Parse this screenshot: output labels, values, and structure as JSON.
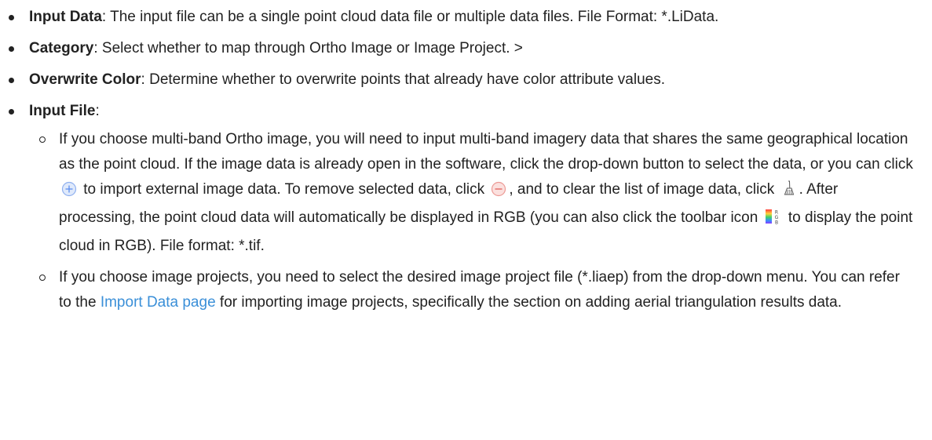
{
  "items": [
    {
      "term": "Input Data",
      "desc": ": The input file can be a single point cloud data file or multiple data files. File Format: *.LiData."
    },
    {
      "term": "Category",
      "desc": ": Select whether to map through Ortho Image or Image Project. >"
    },
    {
      "term": "Overwrite Color",
      "desc": ": Determine whether to overwrite points that already have color attribute values."
    },
    {
      "term": "Input File",
      "desc": ":"
    }
  ],
  "subitems": {
    "ortho": {
      "part1": "If you choose multi-band Ortho image, you will need to input multi-band imagery data that shares the same geographical location as the point cloud. If the image data is already open in the software, click the drop-down button to select the data, or you can click",
      "part2": "to import external image data. To remove selected data, click",
      "part3": ", and to clear the list of image data, click",
      "part4": ". After processing, the point cloud data will automatically be displayed in RGB (you can also click the toolbar icon",
      "part5": "to display the point cloud in RGB). File format: *.tif."
    },
    "project": {
      "part1": "If you choose image projects, you need to select the desired image project file (*.liaep) from the drop-down menu. You can refer to the",
      "link": "Import Data page",
      "part2": "for importing image projects, specifically the section on adding aerial triangulation results data."
    }
  },
  "icons": {
    "add": "add-circle-icon",
    "remove": "remove-circle-icon",
    "clear": "broom-icon",
    "rgb": "rgb-toolbar-icon"
  },
  "colors": {
    "text": "#222222",
    "link": "#3a8fd8",
    "add_icon": "#5b8def",
    "remove_icon": "#e0605a"
  }
}
